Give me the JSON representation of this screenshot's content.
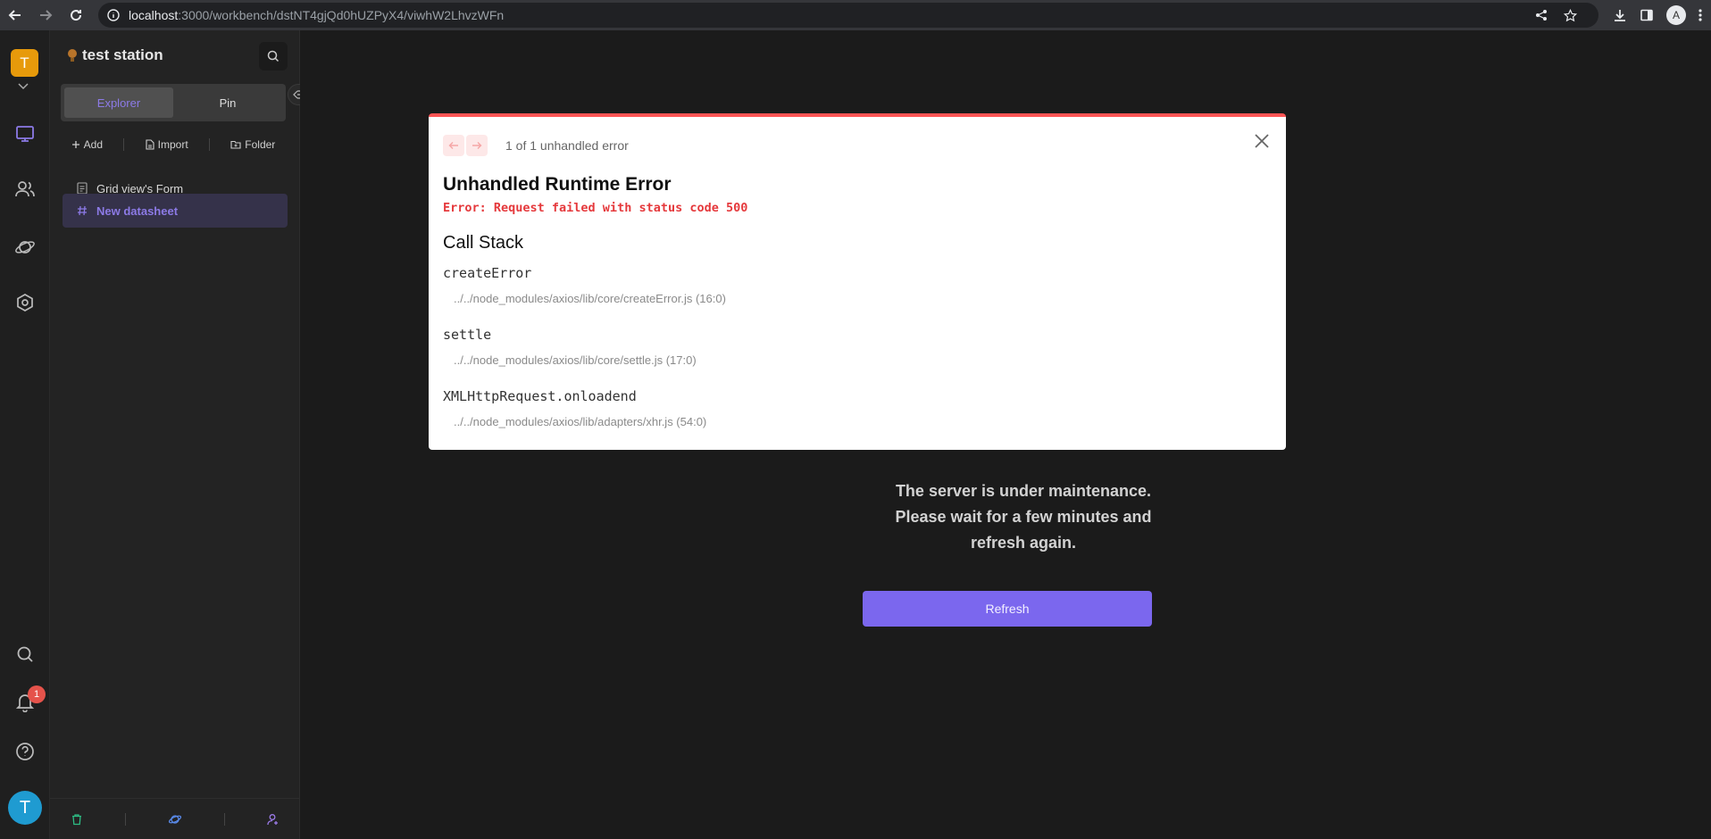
{
  "browser": {
    "url_host": "localhost",
    "url_path": ":3000/workbench/dstNT4gjQd0hUZPyX4/viwhW2LhvzWFn",
    "profile_initial": "A"
  },
  "rail": {
    "space_initial": "T",
    "notification_count": "1",
    "avatar_initial": "T",
    "accent": "#8c7ae6"
  },
  "sidebar": {
    "space_name": "test station",
    "tabs": [
      {
        "label": "Explorer",
        "active": true
      },
      {
        "label": "Pin",
        "active": false
      }
    ],
    "toolbar": {
      "add_label": "Add",
      "import_label": "Import",
      "folder_label": "Folder"
    },
    "nodes": [
      {
        "label": "Grid view's Form",
        "icon": "form-icon"
      },
      {
        "label": "New datasheet",
        "icon": "datasheet-hash-icon",
        "selected": true
      }
    ]
  },
  "main": {
    "maintenance_line1": "The server is under maintenance.",
    "maintenance_line2": "Please wait for a few minutes and",
    "maintenance_line3": "refresh again.",
    "refresh_label": "Refresh"
  },
  "modal": {
    "count_text": "1 of 1 unhandled error",
    "title": "Unhandled Runtime Error",
    "message": "Error: Request failed with status code 500",
    "callstack_title": "Call Stack",
    "frames": [
      {
        "fn": "createError",
        "loc": "../../node_modules/axios/lib/core/createError.js (16:0)"
      },
      {
        "fn": "settle",
        "loc": "../../node_modules/axios/lib/core/settle.js (17:0)"
      },
      {
        "fn": "XMLHttpRequest.onloadend",
        "loc": "../../node_modules/axios/lib/adapters/xhr.js (54:0)"
      }
    ],
    "accent": "#ff5555"
  }
}
